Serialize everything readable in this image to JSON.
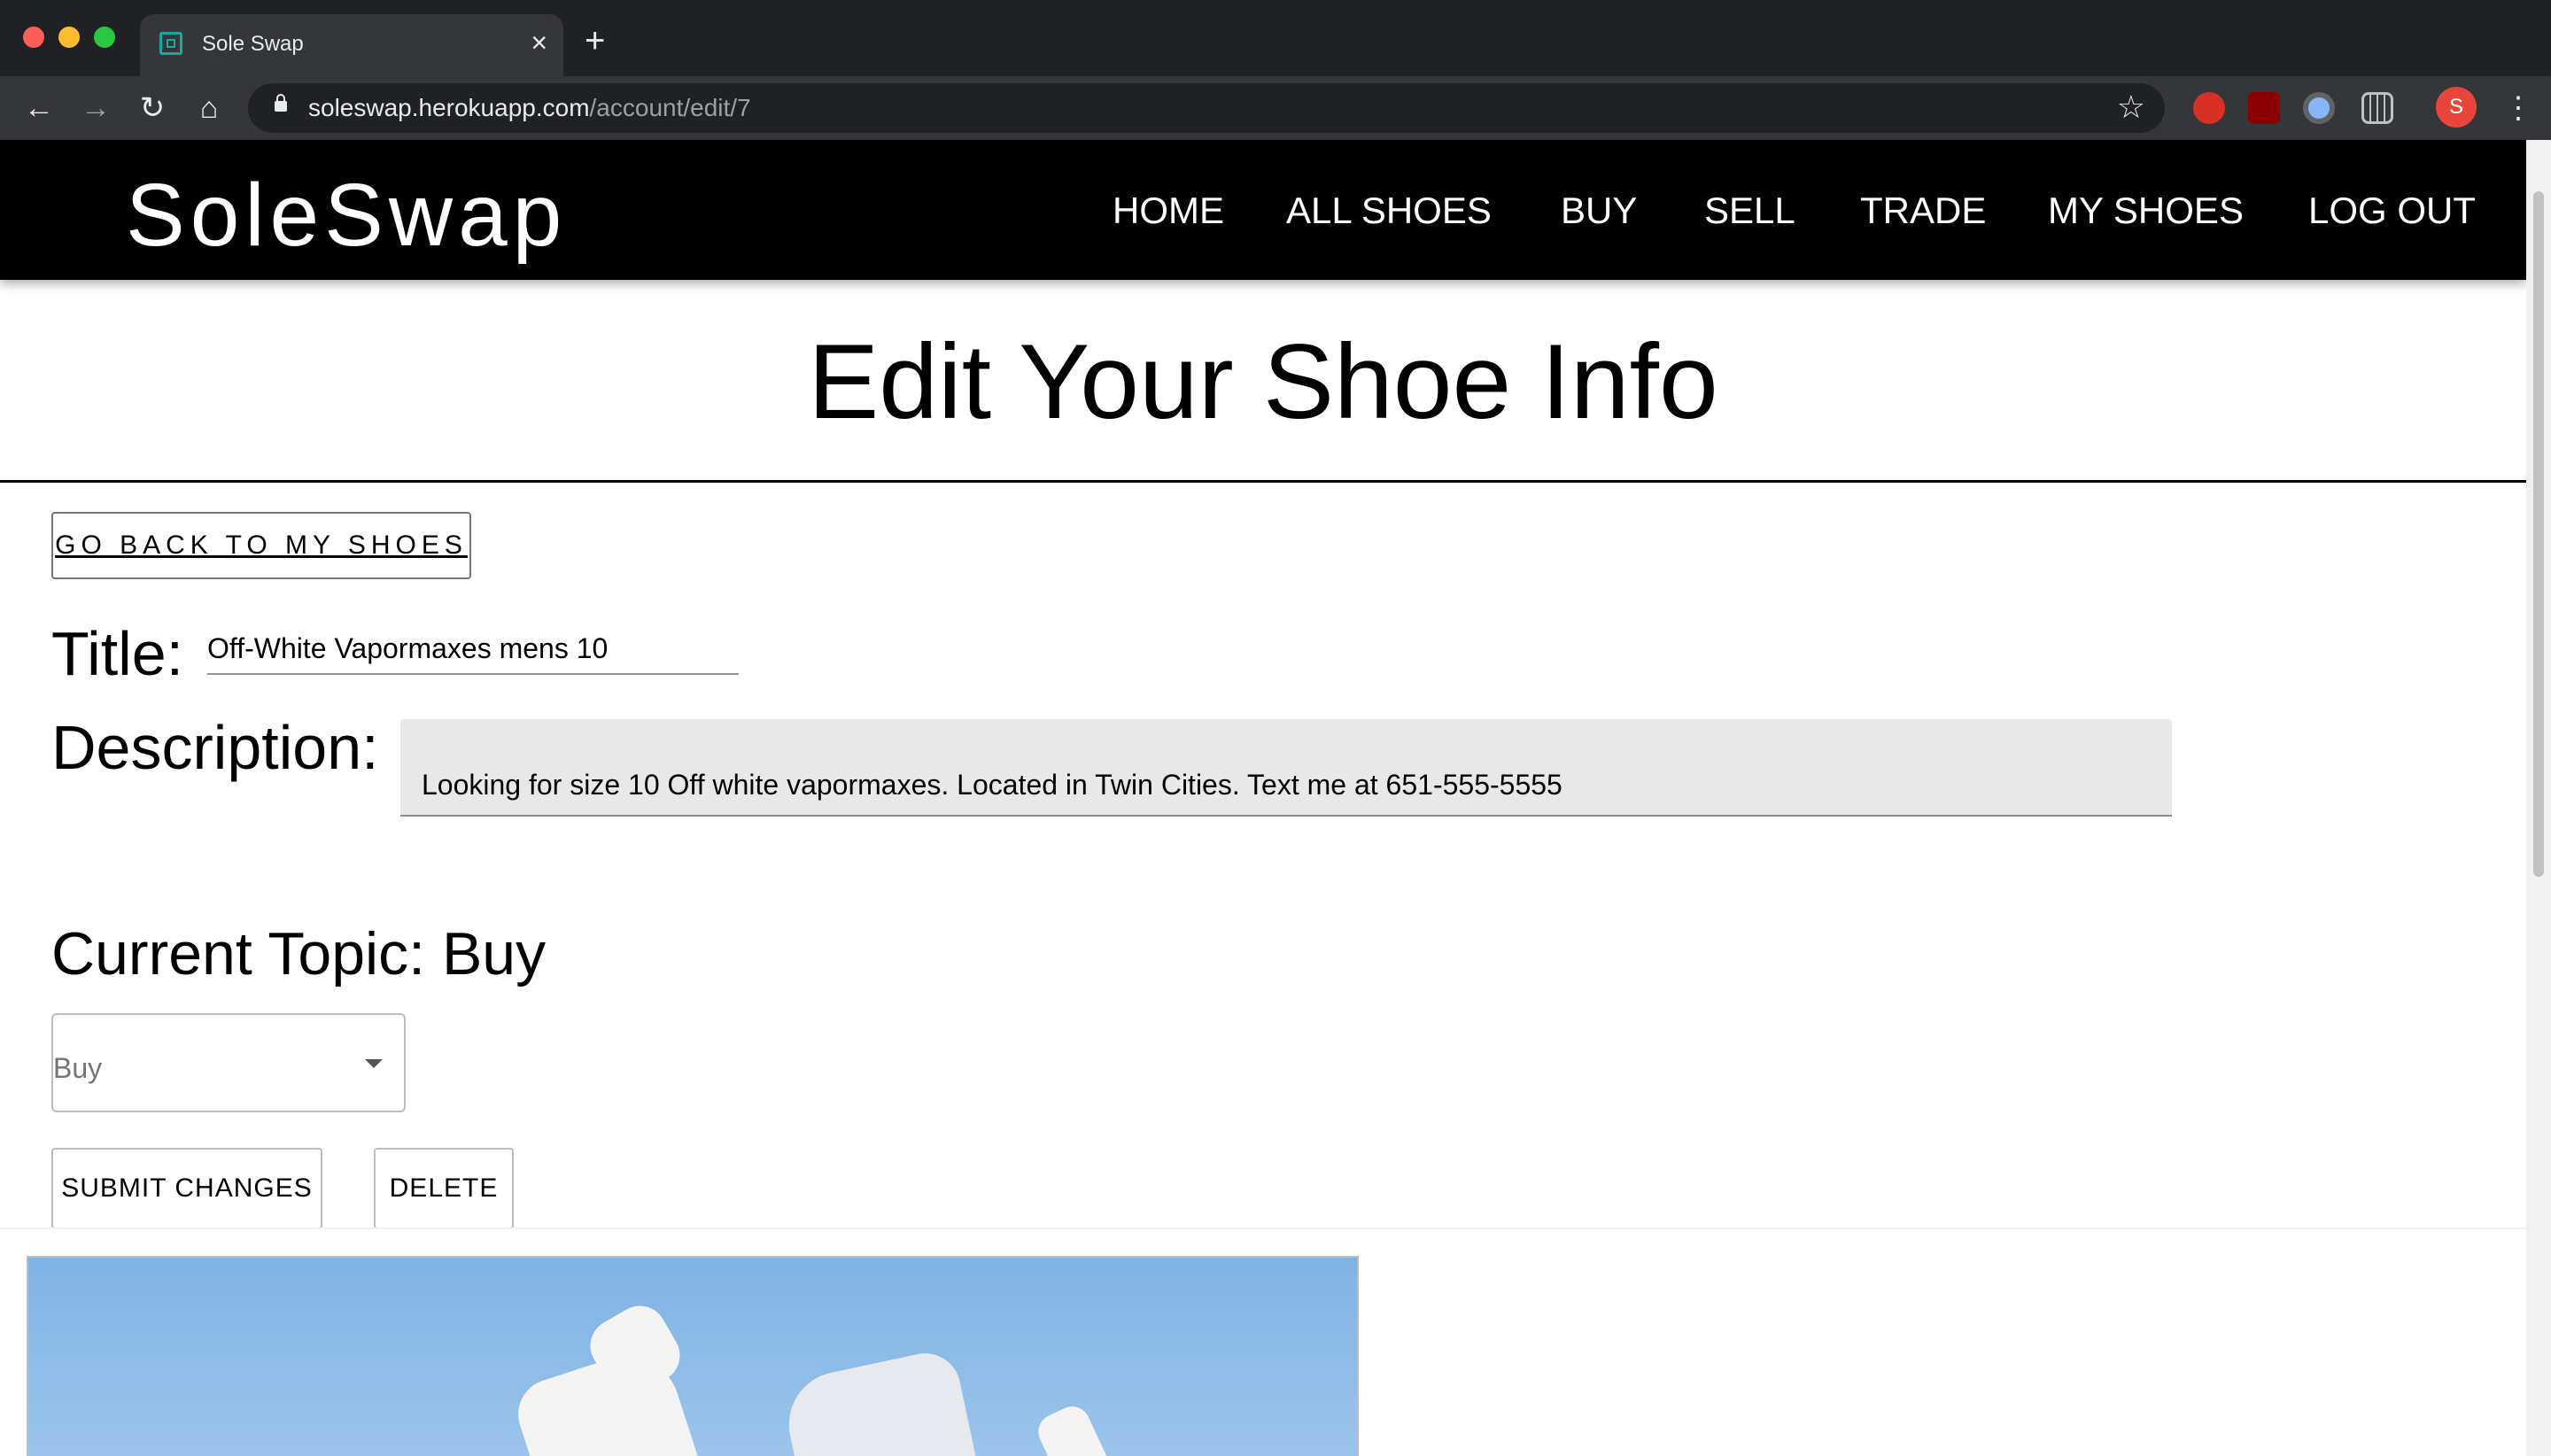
{
  "browser": {
    "tab_title": "Sole Swap",
    "url_host": "soleswap.herokuapp.com",
    "url_path": "/account/edit/7",
    "profile_initial": "S"
  },
  "header": {
    "brand": "SoleSwap",
    "nav": [
      "HOME",
      "ALL SHOES",
      "BUY",
      "SELL",
      "TRADE",
      "MY SHOES",
      "LOG OUT"
    ]
  },
  "page": {
    "title": "Edit Your Shoe Info",
    "back_button": "GO BACK TO MY SHOES"
  },
  "form": {
    "title_label": "Title:",
    "title_value": "Off-White Vapormaxes mens 10",
    "description_label": "Description:",
    "description_value": "Looking for size 10 Off white vapormaxes. Located in Twin Cities. Text me at 651-555-5555",
    "current_topic": "Current Topic: Buy",
    "topic_selected": "Buy",
    "submit_button": "SUBMIT CHANGES",
    "delete_button": "DELETE"
  },
  "colors": {
    "header_bg": "#000000",
    "description_bg": "#e8e8e8",
    "image_sky": "#8fbce8"
  }
}
